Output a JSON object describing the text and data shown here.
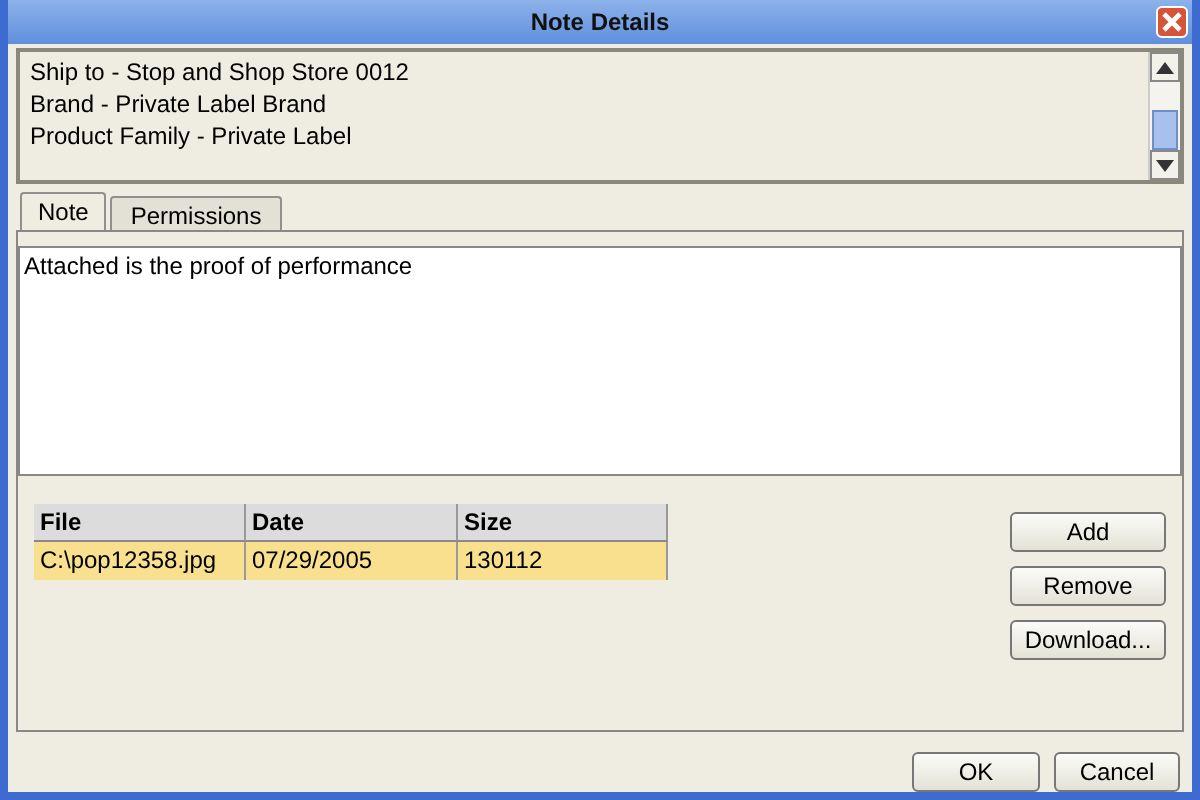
{
  "window": {
    "title": "Note Details"
  },
  "info_lines": [
    "Ship to - Stop and Shop Store 0012",
    "Brand - Private Label Brand",
    "Product Family - Private Label"
  ],
  "tabs": [
    {
      "label": "Note",
      "selected": true
    },
    {
      "label": "Permissions",
      "selected": false
    }
  ],
  "note": {
    "value": "Attached is the proof of performance"
  },
  "table": {
    "columns": [
      "File",
      "Date",
      "Size"
    ],
    "rows": [
      {
        "cells": [
          "C:\\pop12358.jpg",
          "07/29/2005",
          "130112"
        ],
        "selected": true
      }
    ]
  },
  "side_buttons": [
    "Add",
    "Remove",
    "Download..."
  ],
  "footer_buttons": [
    "OK",
    "Cancel"
  ]
}
